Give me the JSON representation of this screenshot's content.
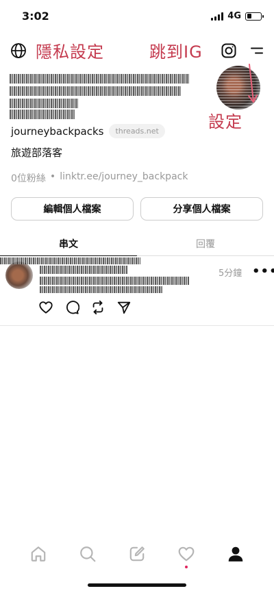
{
  "status": {
    "time": "3:02",
    "network": "4G"
  },
  "annotations": {
    "privacy": "隱私設定",
    "jump_ig": "跳到IG",
    "settings": "設定"
  },
  "profile": {
    "username": "journeybackpacks",
    "domain_badge": "threads.net",
    "bio": "旅遊部落客",
    "followers": "0位粉絲",
    "separator": "•",
    "link": "linktr.ee/journey_backpack"
  },
  "actions": {
    "edit": "編輯個人檔案",
    "share": "分享個人檔案"
  },
  "tabs": {
    "threads": "串文",
    "replies": "回覆"
  },
  "post": {
    "time": "5分鐘",
    "more": "•••"
  },
  "colors": {
    "annotation": "#c43a4e",
    "notification_dot": "#e0245e"
  }
}
